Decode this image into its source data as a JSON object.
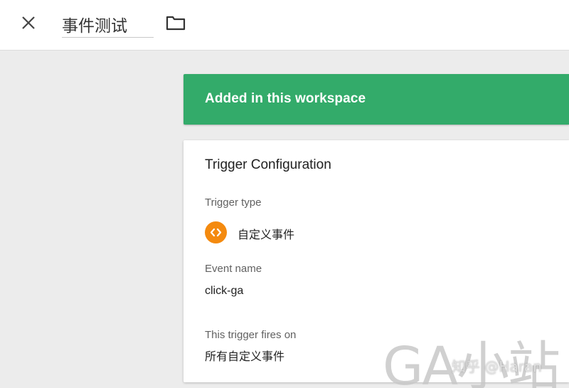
{
  "header": {
    "close_icon": "close-icon",
    "title": "事件测试",
    "folder_icon": "folder-icon"
  },
  "banner": {
    "text": "Added in this workspace",
    "color": "#33ab6a"
  },
  "trigger_config": {
    "title": "Trigger Configuration",
    "trigger_type_label": "Trigger type",
    "trigger_type_icon": "custom-event-code-icon",
    "trigger_type_icon_color": "#f48a0f",
    "trigger_type_value": "自定义事件",
    "event_name_label": "Event name",
    "event_name_value": "click-ga",
    "fires_on_label": "This trigger fires on",
    "fires_on_value": "所有自定义事件"
  },
  "watermark": {
    "main": "GA小站",
    "sub": "知乎 @Haran"
  }
}
